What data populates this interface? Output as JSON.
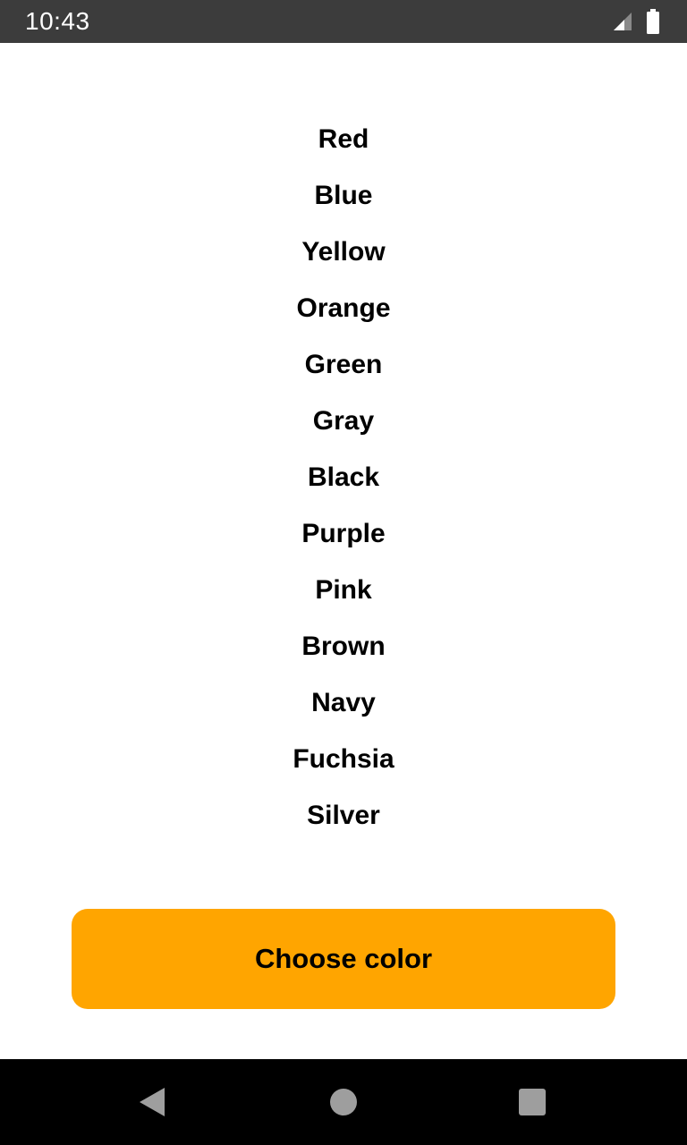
{
  "status_bar": {
    "time": "10:43",
    "icons": [
      "signal-icon",
      "battery-icon"
    ]
  },
  "color_list": {
    "items": [
      {
        "label": "Red"
      },
      {
        "label": "Blue"
      },
      {
        "label": "Yellow"
      },
      {
        "label": "Orange"
      },
      {
        "label": "Green"
      },
      {
        "label": "Gray"
      },
      {
        "label": "Black"
      },
      {
        "label": "Purple"
      },
      {
        "label": "Pink"
      },
      {
        "label": "Brown"
      },
      {
        "label": "Navy"
      },
      {
        "label": "Fuchsia"
      },
      {
        "label": "Silver"
      }
    ]
  },
  "choose_button": {
    "label": "Choose color",
    "color": "#ffa500"
  },
  "nav_bar": {
    "icons": [
      "back-icon",
      "home-icon",
      "recents-icon"
    ]
  },
  "colors": {
    "status_bar_bg": "#3c3c3c",
    "nav_bar_bg": "#000000",
    "accent": "#ffa500",
    "nav_icon": "#9e9e9e"
  }
}
